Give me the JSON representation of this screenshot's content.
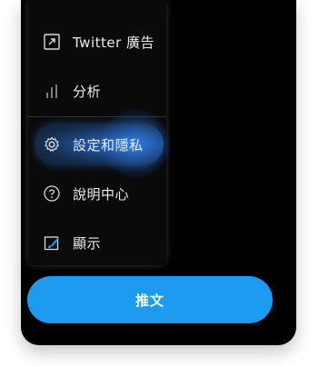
{
  "menu": {
    "items": [
      {
        "label": "Twitter 廣告",
        "icon": "external-link-box-icon"
      },
      {
        "label": "分析",
        "icon": "analytics-bars-icon"
      },
      {
        "label": "設定和隱私",
        "icon": "gear-icon",
        "active": true
      },
      {
        "label": "說明中心",
        "icon": "help-circle-icon"
      },
      {
        "label": "顯示",
        "icon": "display-brush-icon"
      }
    ]
  },
  "tweet_button": {
    "label": "推文"
  },
  "colors": {
    "accent": "#1d9bf0",
    "background": "#000000",
    "menu_background": "#0a0a0a",
    "divider": "#2f3336",
    "text": "#ececec"
  }
}
